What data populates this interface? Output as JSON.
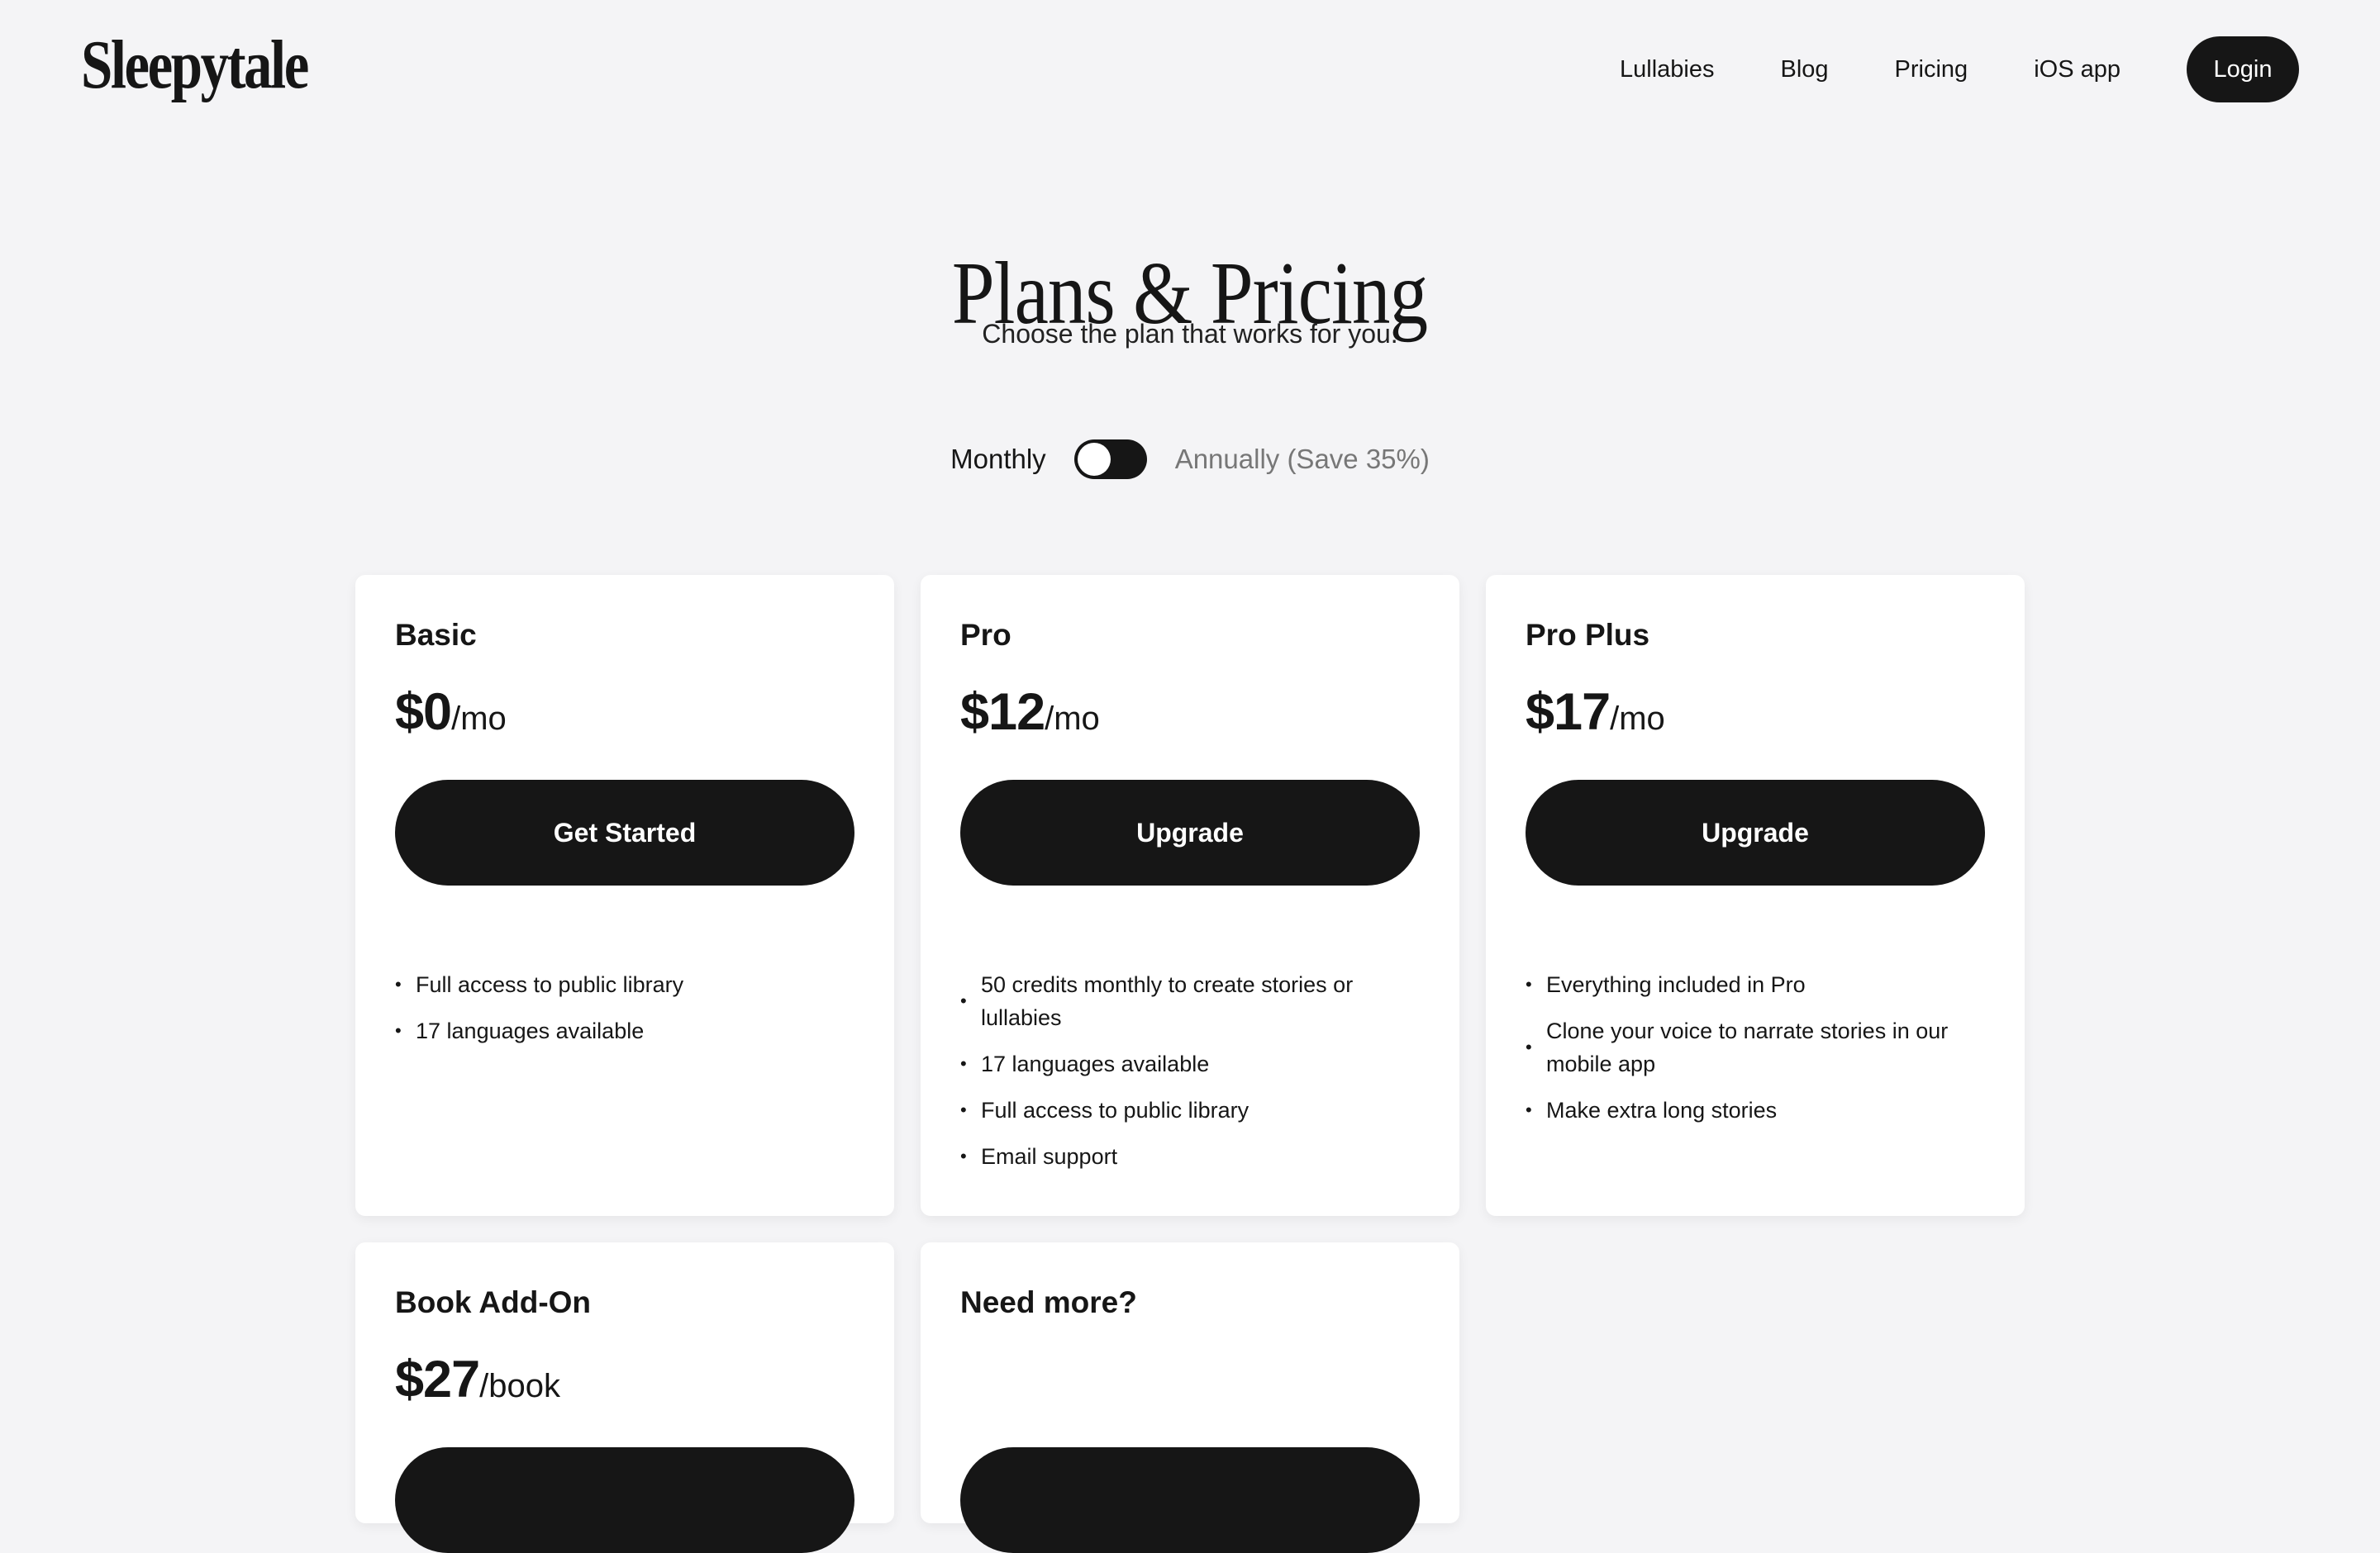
{
  "brand": {
    "logo": "Sleepytale"
  },
  "nav": {
    "links": [
      "Lullabies",
      "Blog",
      "Pricing",
      "iOS app"
    ],
    "login": "Login"
  },
  "hero": {
    "title": "Plans & Pricing",
    "subtitle": "Choose the plan that works for you."
  },
  "billing": {
    "monthly": "Monthly",
    "annually": "Annually (Save 35%)",
    "selected": "Monthly"
  },
  "plans": [
    {
      "name": "Basic",
      "amount": "$0",
      "period": "/mo",
      "cta": "Get Started",
      "features": [
        "Full access to public library",
        "17 languages available"
      ]
    },
    {
      "name": "Pro",
      "amount": "$12",
      "period": "/mo",
      "cta": "Upgrade",
      "features": [
        "50 credits monthly to create stories or lullabies",
        "17 languages available",
        "Full access to public library",
        "Email support"
      ]
    },
    {
      "name": "Pro Plus",
      "amount": "$17",
      "period": "/mo",
      "cta": "Upgrade",
      "features": [
        "Everything included in Pro",
        "Clone your voice to narrate stories in our mobile app",
        "Make extra long stories"
      ]
    },
    {
      "name": "Book Add-On",
      "amount": "$27",
      "period": "/book",
      "cta": ""
    },
    {
      "name": "Need more?",
      "cta": ""
    }
  ]
}
